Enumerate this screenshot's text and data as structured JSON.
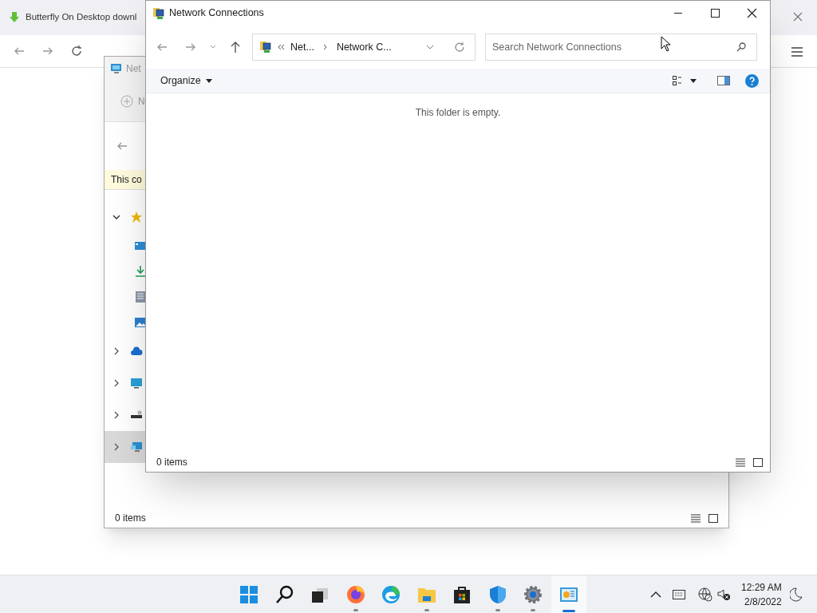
{
  "browser": {
    "tab_title": "Butterfly On Desktop downl"
  },
  "back_window": {
    "title": "Net",
    "command_label": "N",
    "info_bar": "This co",
    "status": "0 items",
    "tree": [
      {
        "kind": "star",
        "expanded": true,
        "selected": false,
        "children": [
          {
            "kind": "desktop",
            "selected": false
          },
          {
            "kind": "download",
            "selected": false
          },
          {
            "kind": "documents",
            "selected": false
          },
          {
            "kind": "pictures",
            "selected": false
          }
        ]
      },
      {
        "kind": "cloud",
        "expanded": false,
        "selected": false
      },
      {
        "kind": "monitor",
        "expanded": false,
        "selected": false
      },
      {
        "kind": "drive",
        "expanded": false,
        "selected": false
      },
      {
        "kind": "network",
        "expanded": false,
        "selected": true
      }
    ]
  },
  "front_window": {
    "title": "Network Connections",
    "breadcrumb": [
      "Net...",
      "Network C..."
    ],
    "search": {
      "placeholder": "Search Network Connections"
    },
    "command": "Organize",
    "empty_message": "This folder is empty.",
    "status": "0 items"
  },
  "taskbar": {
    "apps": [
      {
        "kind": "start",
        "running": false,
        "active": false
      },
      {
        "kind": "search",
        "running": false,
        "active": false
      },
      {
        "kind": "taskview",
        "running": false,
        "active": false
      },
      {
        "kind": "firefox",
        "running": true,
        "active": false
      },
      {
        "kind": "edge",
        "running": false,
        "active": false
      },
      {
        "kind": "folder",
        "running": true,
        "active": false
      },
      {
        "kind": "store",
        "running": false,
        "active": false
      },
      {
        "kind": "shield",
        "running": true,
        "active": false
      },
      {
        "kind": "settings",
        "running": true,
        "active": false
      },
      {
        "kind": "network",
        "running": true,
        "active": true
      }
    ],
    "time": "12:29 AM",
    "date": "2/8/2022"
  }
}
